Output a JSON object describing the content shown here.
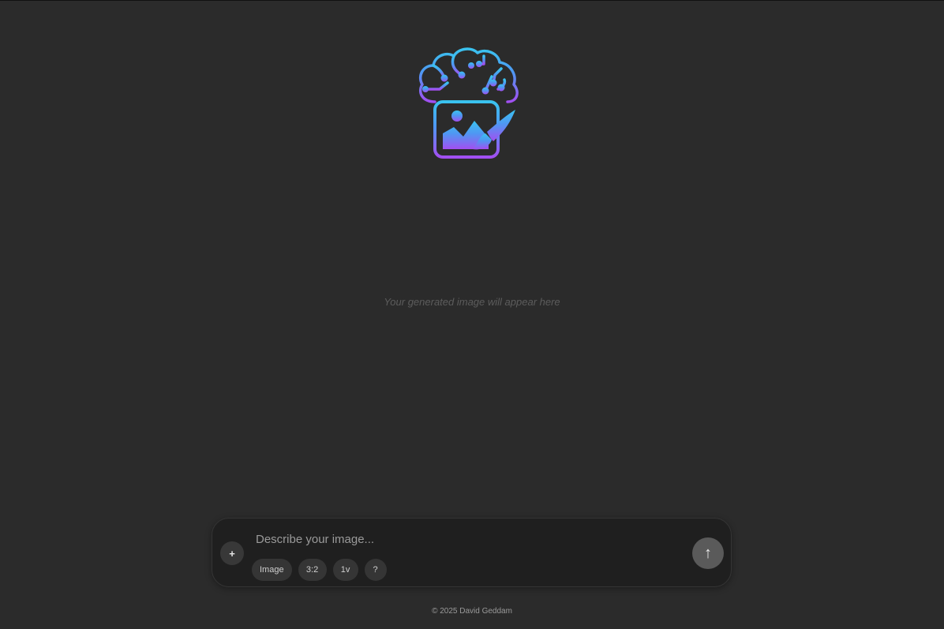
{
  "logo": {
    "icon": "brain-image-brush-icon",
    "gradient_top": "#38bdf8",
    "gradient_bottom": "#a855f7"
  },
  "output": {
    "placeholder": "Your generated image will appear here"
  },
  "composer": {
    "add_label": "+",
    "prompt_placeholder": "Describe your image...",
    "prompt_value": "",
    "options": {
      "mode_label": "Image",
      "aspect_ratio_label": "3:2",
      "count_label": "1v",
      "help_label": "?"
    },
    "send_label": "↑"
  },
  "footer": {
    "copyright": "© 2025 David Geddam"
  }
}
